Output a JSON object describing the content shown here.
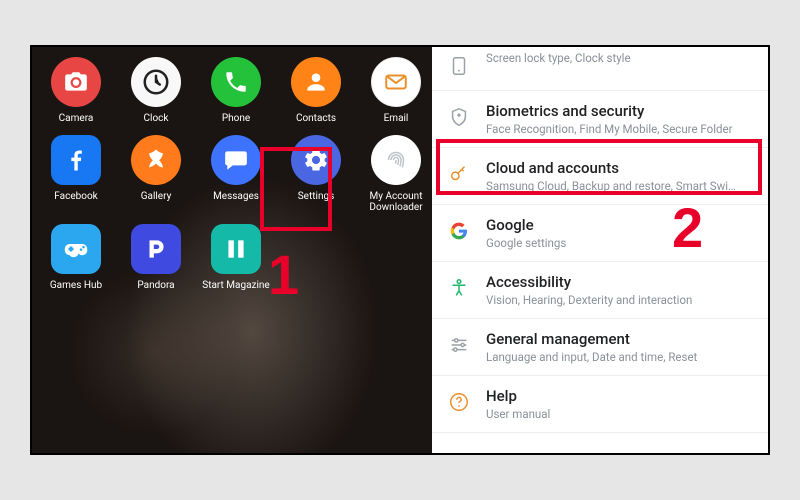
{
  "apps": {
    "row1": [
      {
        "name": "camera",
        "label": "Camera"
      },
      {
        "name": "clock",
        "label": "Clock"
      },
      {
        "name": "phone",
        "label": "Phone"
      },
      {
        "name": "contacts",
        "label": "Contacts"
      },
      {
        "name": "email",
        "label": "Email"
      }
    ],
    "row2": [
      {
        "name": "facebook",
        "label": "Facebook"
      },
      {
        "name": "gallery",
        "label": "Gallery"
      },
      {
        "name": "messages",
        "label": "Messages"
      },
      {
        "name": "settings",
        "label": "Settings"
      },
      {
        "name": "myaccount",
        "label": "My Account Downloader"
      }
    ],
    "row3": [
      {
        "name": "gameshub",
        "label": "Games Hub"
      },
      {
        "name": "pandora",
        "label": "Pandora"
      },
      {
        "name": "startmag",
        "label": "Start Magazine"
      }
    ]
  },
  "settings": {
    "items": [
      {
        "key": "lockscreen",
        "title": "",
        "sub": "Screen lock type, Clock style"
      },
      {
        "key": "biometrics",
        "title": "Biometrics and security",
        "sub": "Face Recognition, Find My Mobile, Secure Folder"
      },
      {
        "key": "cloud",
        "title": "Cloud and accounts",
        "sub": "Samsung Cloud, Backup and restore, Smart Swi…"
      },
      {
        "key": "google",
        "title": "Google",
        "sub": "Google settings"
      },
      {
        "key": "accessibility",
        "title": "Accessibility",
        "sub": "Vision, Hearing, Dexterity and interaction"
      },
      {
        "key": "general",
        "title": "General management",
        "sub": "Language and input, Date and time, Reset"
      },
      {
        "key": "help",
        "title": "Help",
        "sub": "User manual"
      }
    ]
  },
  "callouts": {
    "step1": "1",
    "step2": "2"
  },
  "colors": {
    "highlight": "#e8002b"
  }
}
